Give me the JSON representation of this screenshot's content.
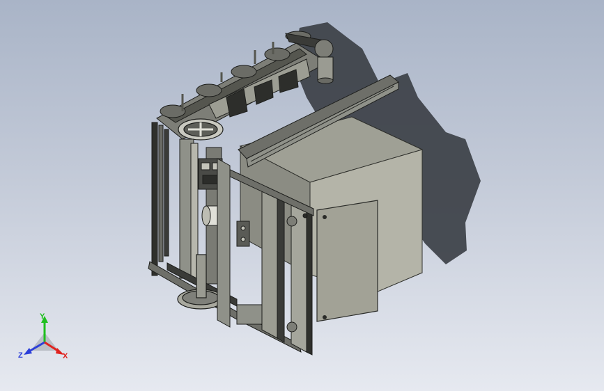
{
  "viewport": {
    "background_top": "#a9b4c7",
    "background_bottom": "#e6e9f0"
  },
  "model": {
    "part_icon": "cad-assembly-icon",
    "metal_color": "#8f9189",
    "panel_color": "#a8a89c",
    "dark_color": "#3a3b38",
    "shadow_color": "#3c4046"
  },
  "triad": {
    "icon": "coordinate-triad-icon",
    "y_label": "Y",
    "z_label": "Z",
    "x_label": "X",
    "y_color": "#1fbf1f",
    "z_color": "#2c3fd9",
    "x_color": "#e0231f"
  }
}
